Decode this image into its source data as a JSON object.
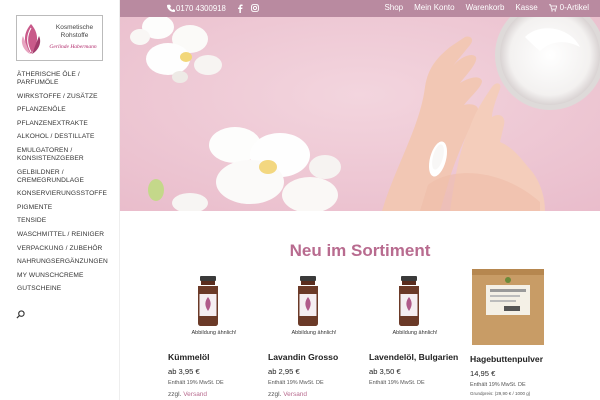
{
  "logo": {
    "line1": "Kosmetische",
    "line2": "Rohstoffe",
    "owner": "Gerlinde Habermann"
  },
  "sidebar": {
    "items": [
      {
        "label": "ÄTHERISCHE ÖLE / PARFUMÖLE"
      },
      {
        "label": "WIRKSTOFFE / ZUSÄTZE"
      },
      {
        "label": "PFLANZENÖLE"
      },
      {
        "label": "PFLANZENEXTRAKTE"
      },
      {
        "label": "ALKOHOL / DESTILLATE"
      },
      {
        "label": "EMULGATOREN / KONSISTENZGEBER"
      },
      {
        "label": "GELBILDNER / CREMEGRUNDLAGE"
      },
      {
        "label": "KONSERVIERUNGSSTOFFE"
      },
      {
        "label": "PIGMENTE"
      },
      {
        "label": "TENSIDE"
      },
      {
        "label": "WASCHMITTEL / REINIGER"
      },
      {
        "label": "VERPACKUNG / ZUBEHÖR"
      },
      {
        "label": "NAHRUNGSERGÄNZUNGEN"
      },
      {
        "label": "MY WUNSCHCREME"
      },
      {
        "label": "GUTSCHEINE"
      }
    ]
  },
  "topbar": {
    "phone": "0170 4300918",
    "nav": [
      "Shop",
      "Mein Konto",
      "Warenkorb",
      "Kasse"
    ],
    "cart_label": "0-Artikel"
  },
  "section": {
    "title": "Neu im Sortiment"
  },
  "products": [
    {
      "caption": "Abbildung ähnlich!",
      "name": "Kümmelöl",
      "price": "ab 3,95 €",
      "tax": "Enthält 19% MwSt. DE",
      "ship_prefix": "zzgl.",
      "ship_link": "Versand",
      "grund": ""
    },
    {
      "caption": "Abbildung ähnlich!",
      "name": "Lavandin Grosso",
      "price": "ab 2,95 €",
      "tax": "Enthält 19% MwSt. DE",
      "ship_prefix": "zzgl.",
      "ship_link": "Versand",
      "grund": ""
    },
    {
      "caption": "Abbildung ähnlich!",
      "name": "Lavendelöl, Bulgarien",
      "price": "ab 3,50 €",
      "tax": "Enthält 19% MwSt. DE",
      "ship_prefix": "",
      "ship_link": "",
      "grund": ""
    },
    {
      "caption": "",
      "name": "Hagebuttenpulver",
      "price": "14,95 €",
      "tax": "Enthält 19% MwSt. DE",
      "ship_prefix": "",
      "ship_link": "",
      "grund": "Grundpreis: (29,90 € / 1000 g)"
    }
  ],
  "colors": {
    "topbar": "#b98aa0",
    "accent": "#b86b8f",
    "hero_bg": "#efcbd6"
  }
}
